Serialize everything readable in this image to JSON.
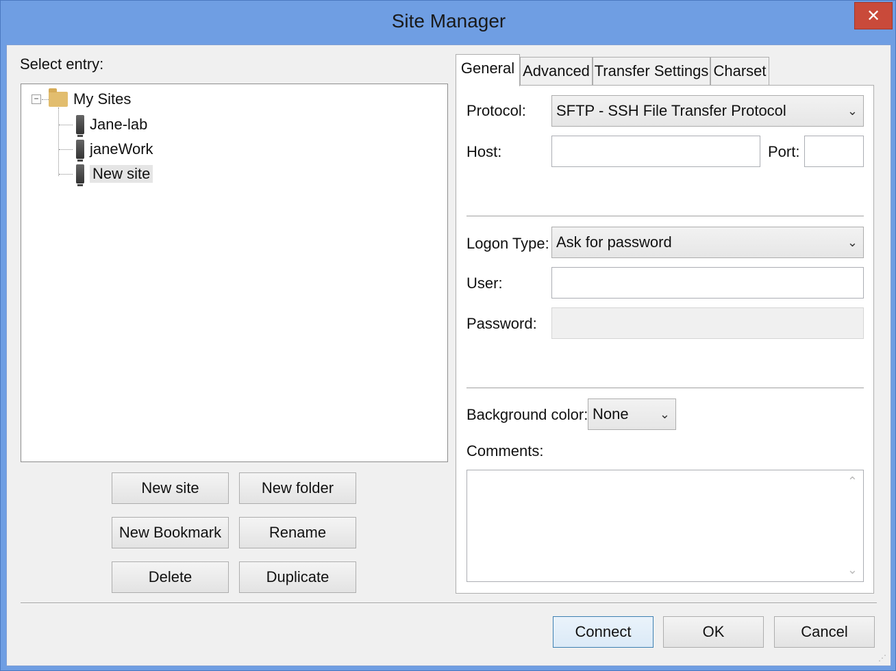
{
  "window": {
    "title": "Site Manager",
    "close_glyph": "✕"
  },
  "tree": {
    "select_label": "Select entry:",
    "root": {
      "label": "My Sites",
      "icon": "folder-icon",
      "expander": "−"
    },
    "items": [
      {
        "label": "Jane-lab",
        "icon": "server-icon"
      },
      {
        "label": "janeWork",
        "icon": "server-icon"
      },
      {
        "label": "New site",
        "icon": "server-icon",
        "selected": true
      }
    ]
  },
  "left_buttons": {
    "new_site": "New site",
    "new_folder": "New folder",
    "new_bookmark": "New Bookmark",
    "rename": "Rename",
    "delete": "Delete",
    "duplicate": "Duplicate"
  },
  "tabs": [
    "General",
    "Advanced",
    "Transfer Settings",
    "Charset"
  ],
  "general": {
    "protocol_label": "Protocol:",
    "protocol_value": "SFTP - SSH File Transfer Protocol",
    "host_label": "Host:",
    "host_value": "",
    "port_label": "Port:",
    "port_value": "",
    "logon_type_label": "Logon Type:",
    "logon_type_value": "Ask for password",
    "user_label": "User:",
    "user_value": "",
    "password_label": "Password:",
    "password_value": "",
    "bg_color_label": "Background color:",
    "bg_color_value": "None",
    "comments_label": "Comments:",
    "comments_value": ""
  },
  "dialog_buttons": {
    "connect": "Connect",
    "ok": "OK",
    "cancel": "Cancel"
  },
  "glyphs": {
    "dropdown": "⌄",
    "scroll_up": "⌃",
    "scroll_down": "⌄"
  },
  "colors": {
    "titlebar": "#6f9ee3",
    "close": "#c94a3a",
    "folder": "#e2bd6e"
  }
}
